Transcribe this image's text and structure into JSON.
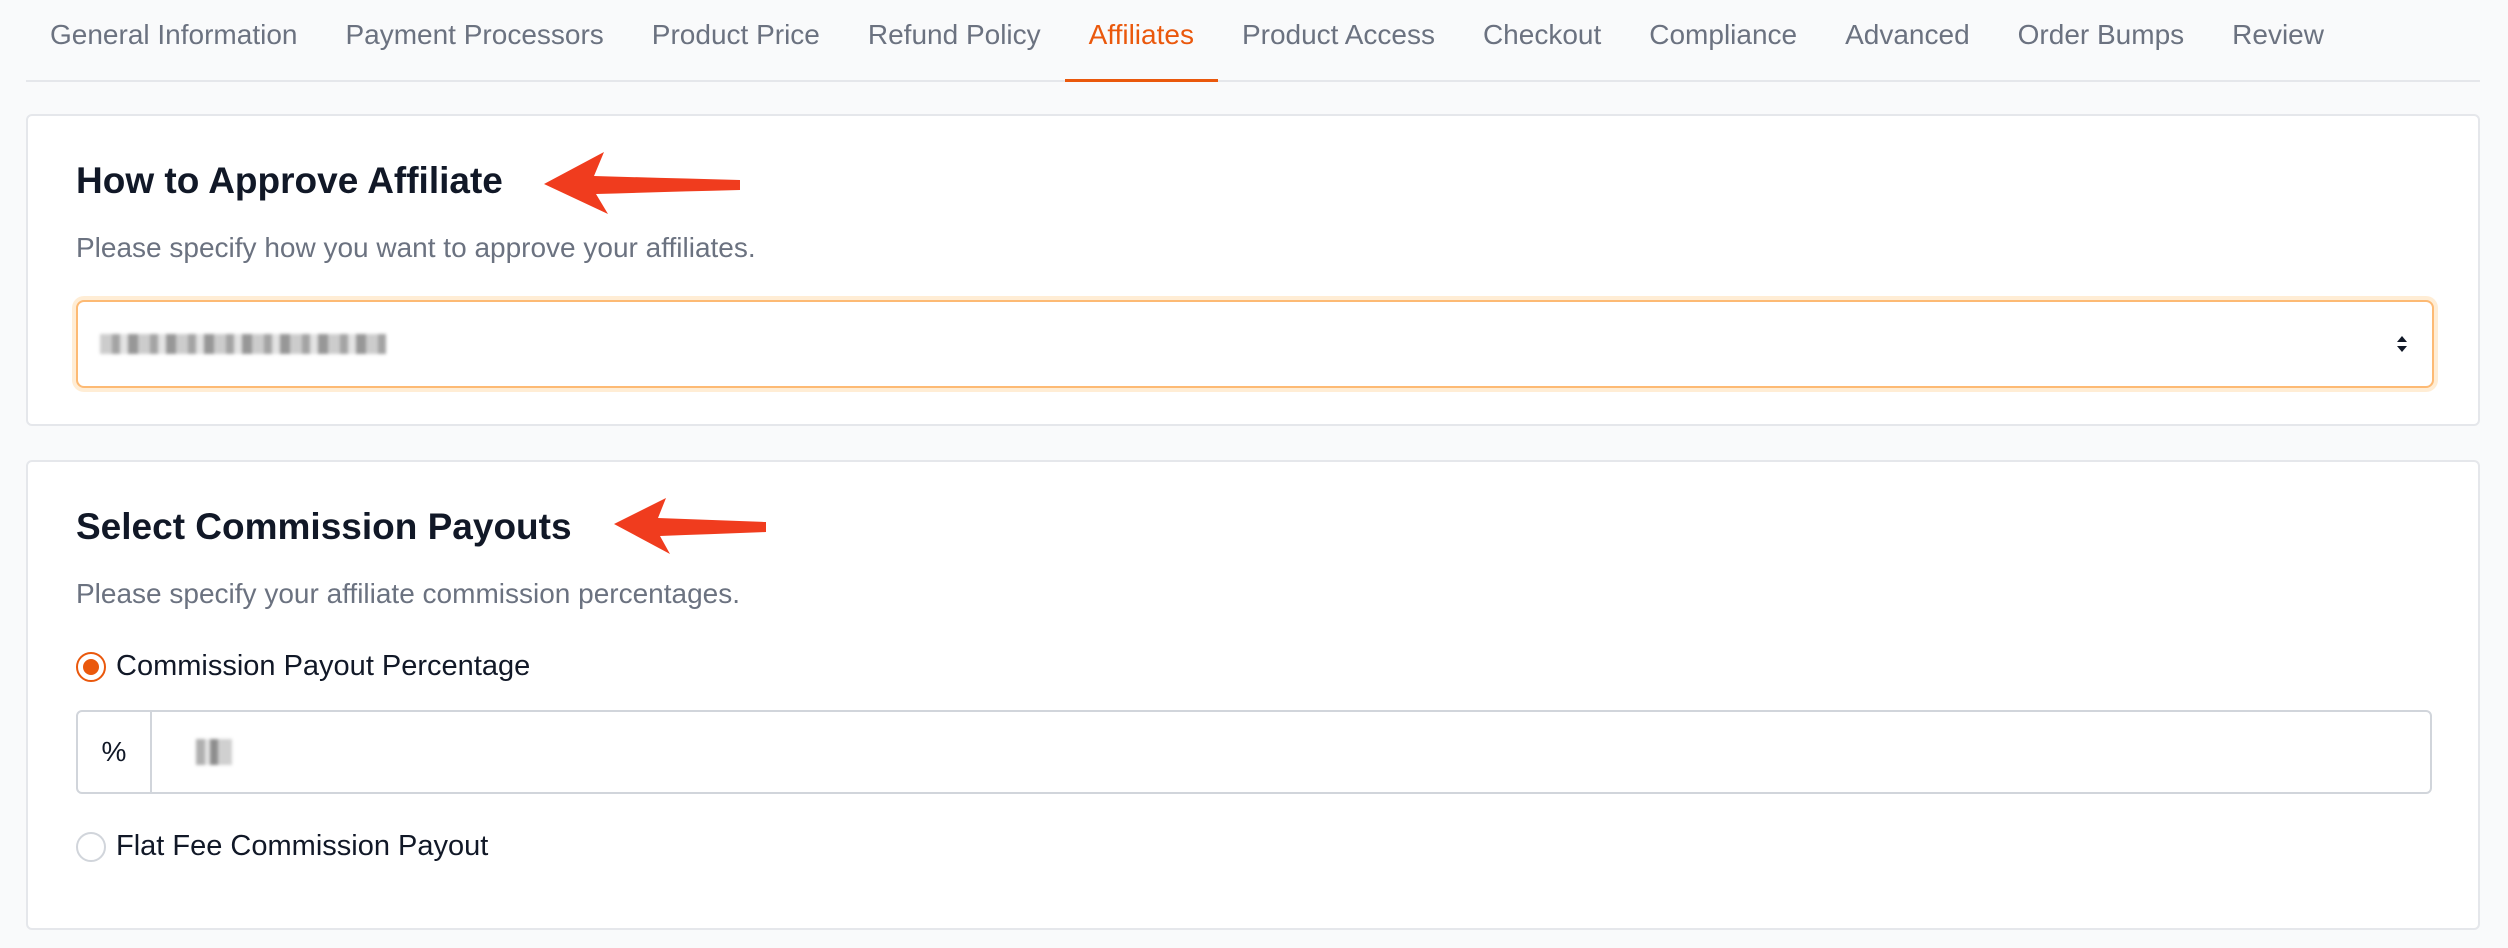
{
  "tabs": [
    {
      "label": "General Information",
      "active": false
    },
    {
      "label": "Payment Processors",
      "active": false
    },
    {
      "label": "Product Price",
      "active": false
    },
    {
      "label": "Refund Policy",
      "active": false
    },
    {
      "label": "Affiliates",
      "active": true
    },
    {
      "label": "Product Access",
      "active": false
    },
    {
      "label": "Checkout",
      "active": false
    },
    {
      "label": "Compliance",
      "active": false
    },
    {
      "label": "Advanced",
      "active": false
    },
    {
      "label": "Order Bumps",
      "active": false
    },
    {
      "label": "Review",
      "active": false
    }
  ],
  "approve": {
    "title": "How to Approve Affiliate",
    "description": "Please specify how you want to approve your affiliates.",
    "select_value_icon": "redacted-text"
  },
  "commission": {
    "title": "Select Commission Payouts",
    "description": "Please specify your affiliate commission percentages.",
    "options": [
      {
        "label": "Commission Payout Percentage",
        "selected": true
      },
      {
        "label": "Flat Fee Commission Payout",
        "selected": false
      }
    ],
    "percent_addon": "%",
    "percent_value_icon": "redacted-text"
  },
  "colors": {
    "accent": "#ea580c",
    "annotation_arrow": "#f03c1e",
    "text_muted": "#6b7280",
    "border": "#e5e7eb"
  }
}
